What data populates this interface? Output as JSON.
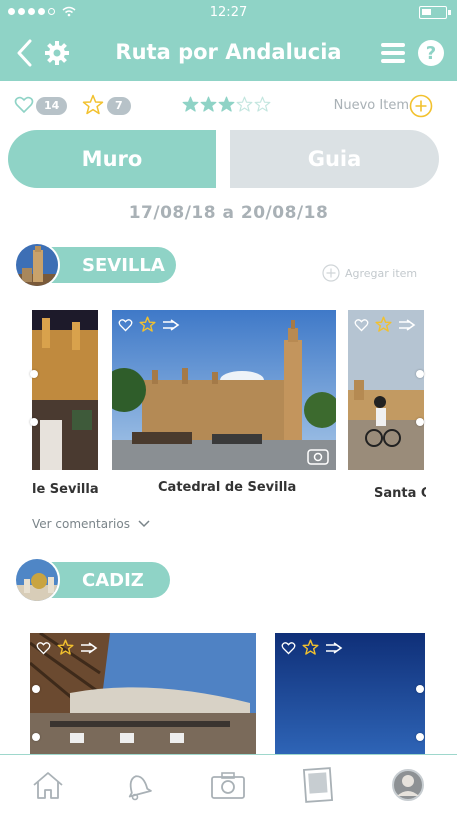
{
  "status_bar": {
    "time": "12:27",
    "signal_dots_filled": 4,
    "signal_dots_total": 5
  },
  "header": {
    "title": "Ruta por Andalucia",
    "back_icon": "chevron-left-icon",
    "settings_icon": "gear-icon",
    "menu_icon": "hamburger-icon",
    "help_icon": "question-icon"
  },
  "stats": {
    "likes": "14",
    "stars": "7",
    "rating": 3,
    "rating_max": 5,
    "new_item_label": "Nuevo Item"
  },
  "tabs": {
    "muro": "Muro",
    "guia": "Guia"
  },
  "dates": "17/08/18 a 20/08/18",
  "sections": [
    {
      "city": "SEVILLA",
      "add_label": "Agregar item",
      "cards": [
        {
          "label": "le Sevilla"
        },
        {
          "label": "Catedral de Sevilla"
        },
        {
          "label": "Santa C"
        }
      ],
      "comments_label": "Ver comentarios"
    },
    {
      "city": "CADIZ"
    }
  ],
  "colors": {
    "accent": "#8fd3c6",
    "inactive_tab": "#dbe1e4",
    "star": "#f2c12e",
    "muted": "#a9b1b6"
  },
  "bottom_nav": [
    "home-icon",
    "bell-icon",
    "camera-icon",
    "photo-icon",
    "profile-icon"
  ]
}
